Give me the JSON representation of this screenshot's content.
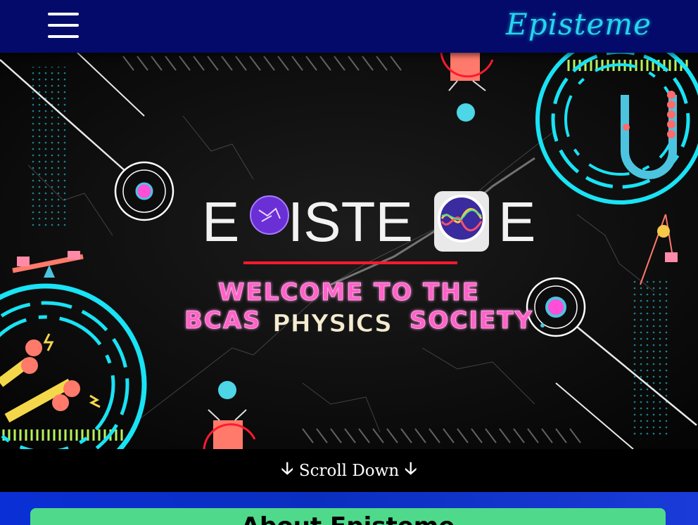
{
  "navbar": {
    "brand": "Episteme",
    "menu_icon": "hamburger-menu-icon"
  },
  "hero": {
    "logo_letters_left": "E",
    "logo_letters_mid": "ISTE",
    "logo_letters_right": "E",
    "welcome_line1": "WELCOME TO THE",
    "welcome_line2_a": "BCAS",
    "welcome_line2_b": "PHYSICS",
    "welcome_line2_c": "SOCIETY",
    "colors": {
      "cyan": "#19e3f5",
      "pink": "#ff4fd8",
      "coral": "#ff7a6b",
      "red": "#ff1a2e",
      "lime": "#b7f25a"
    }
  },
  "scroll": {
    "label": "Scroll Down",
    "icon": "arrow-down-icon"
  },
  "about": {
    "title": "About Episteme"
  }
}
